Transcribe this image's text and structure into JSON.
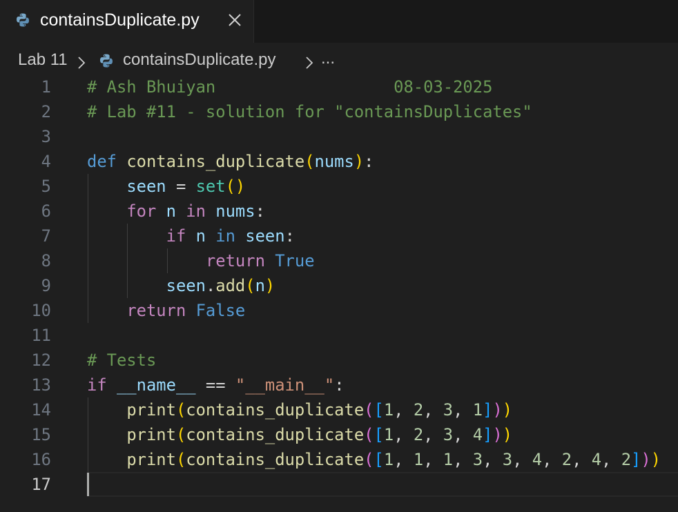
{
  "tab": {
    "title": "containsDuplicate.py",
    "close_glyph": "×",
    "icon": "python-icon"
  },
  "breadcrumb": {
    "folder": "Lab 11",
    "file": "containsDuplicate.py",
    "ellipsis": "...",
    "separator_icon": "chevron-right-icon"
  },
  "editor": {
    "active_line": 17,
    "lines": [
      {
        "n": "1",
        "tokens": [
          [
            "cm",
            "# Ash Bhuiyan                  08-03-2025"
          ]
        ]
      },
      {
        "n": "2",
        "tokens": [
          [
            "cm",
            "# Lab #11 - solution for \"containsDuplicates\""
          ]
        ]
      },
      {
        "n": "3",
        "tokens": []
      },
      {
        "n": "4",
        "tokens": [
          [
            "kw",
            "def"
          ],
          [
            "tx",
            " "
          ],
          [
            "fn",
            "contains_duplicate"
          ],
          [
            "p1",
            "("
          ],
          [
            "var",
            "nums"
          ],
          [
            "p1",
            ")"
          ],
          [
            "tx",
            ":"
          ]
        ]
      },
      {
        "n": "5",
        "tokens": [
          [
            "tx",
            "    "
          ],
          [
            "var",
            "seen"
          ],
          [
            "tx",
            " = "
          ],
          [
            "cls",
            "set"
          ],
          [
            "p1",
            "()"
          ]
        ]
      },
      {
        "n": "6",
        "tokens": [
          [
            "tx",
            "    "
          ],
          [
            "ctl",
            "for"
          ],
          [
            "tx",
            " "
          ],
          [
            "var",
            "n"
          ],
          [
            "tx",
            " "
          ],
          [
            "ctl",
            "in"
          ],
          [
            "tx",
            " "
          ],
          [
            "var",
            "nums"
          ],
          [
            "tx",
            ":"
          ]
        ]
      },
      {
        "n": "7",
        "tokens": [
          [
            "tx",
            "        "
          ],
          [
            "ctl",
            "if"
          ],
          [
            "tx",
            " "
          ],
          [
            "var",
            "n"
          ],
          [
            "tx",
            " "
          ],
          [
            "kw",
            "in"
          ],
          [
            "tx",
            " "
          ],
          [
            "var",
            "seen"
          ],
          [
            "tx",
            ":"
          ]
        ]
      },
      {
        "n": "8",
        "tokens": [
          [
            "tx",
            "            "
          ],
          [
            "ctl",
            "return"
          ],
          [
            "tx",
            " "
          ],
          [
            "kw",
            "True"
          ]
        ]
      },
      {
        "n": "9",
        "tokens": [
          [
            "tx",
            "        "
          ],
          [
            "var",
            "seen"
          ],
          [
            "tx",
            "."
          ],
          [
            "fn",
            "add"
          ],
          [
            "p1",
            "("
          ],
          [
            "var",
            "n"
          ],
          [
            "p1",
            ")"
          ]
        ]
      },
      {
        "n": "10",
        "tokens": [
          [
            "tx",
            "    "
          ],
          [
            "ctl",
            "return"
          ],
          [
            "tx",
            " "
          ],
          [
            "kw",
            "False"
          ]
        ]
      },
      {
        "n": "11",
        "tokens": []
      },
      {
        "n": "12",
        "tokens": [
          [
            "cm",
            "# Tests"
          ]
        ]
      },
      {
        "n": "13",
        "tokens": [
          [
            "ctl",
            "if"
          ],
          [
            "tx",
            " "
          ],
          [
            "var",
            "__name__"
          ],
          [
            "tx",
            " == "
          ],
          [
            "str",
            "\"__main__\""
          ],
          [
            "tx",
            ":"
          ]
        ]
      },
      {
        "n": "14",
        "tokens": [
          [
            "tx",
            "    "
          ],
          [
            "fn",
            "print"
          ],
          [
            "p1",
            "("
          ],
          [
            "fn",
            "contains_duplicate"
          ],
          [
            "p2",
            "("
          ],
          [
            "p3",
            "["
          ],
          [
            "num",
            "1"
          ],
          [
            "tx",
            ", "
          ],
          [
            "num",
            "2"
          ],
          [
            "tx",
            ", "
          ],
          [
            "num",
            "3"
          ],
          [
            "tx",
            ", "
          ],
          [
            "num",
            "1"
          ],
          [
            "p3",
            "]"
          ],
          [
            "p2",
            ")"
          ],
          [
            "p1",
            ")"
          ]
        ]
      },
      {
        "n": "15",
        "tokens": [
          [
            "tx",
            "    "
          ],
          [
            "fn",
            "print"
          ],
          [
            "p1",
            "("
          ],
          [
            "fn",
            "contains_duplicate"
          ],
          [
            "p2",
            "("
          ],
          [
            "p3",
            "["
          ],
          [
            "num",
            "1"
          ],
          [
            "tx",
            ", "
          ],
          [
            "num",
            "2"
          ],
          [
            "tx",
            ", "
          ],
          [
            "num",
            "3"
          ],
          [
            "tx",
            ", "
          ],
          [
            "num",
            "4"
          ],
          [
            "p3",
            "]"
          ],
          [
            "p2",
            ")"
          ],
          [
            "p1",
            ")"
          ]
        ]
      },
      {
        "n": "16",
        "tokens": [
          [
            "tx",
            "    "
          ],
          [
            "fn",
            "print"
          ],
          [
            "p1",
            "("
          ],
          [
            "fn",
            "contains_duplicate"
          ],
          [
            "p2",
            "("
          ],
          [
            "p3",
            "["
          ],
          [
            "num",
            "1"
          ],
          [
            "tx",
            ", "
          ],
          [
            "num",
            "1"
          ],
          [
            "tx",
            ", "
          ],
          [
            "num",
            "1"
          ],
          [
            "tx",
            ", "
          ],
          [
            "num",
            "3"
          ],
          [
            "tx",
            ", "
          ],
          [
            "num",
            "3"
          ],
          [
            "tx",
            ", "
          ],
          [
            "num",
            "4"
          ],
          [
            "tx",
            ", "
          ],
          [
            "num",
            "2"
          ],
          [
            "tx",
            ", "
          ],
          [
            "num",
            "4"
          ],
          [
            "tx",
            ", "
          ],
          [
            "num",
            "2"
          ],
          [
            "p3",
            "]"
          ],
          [
            "p2",
            ")"
          ],
          [
            "p1",
            ")"
          ]
        ]
      },
      {
        "n": "17",
        "tokens": []
      }
    ]
  }
}
